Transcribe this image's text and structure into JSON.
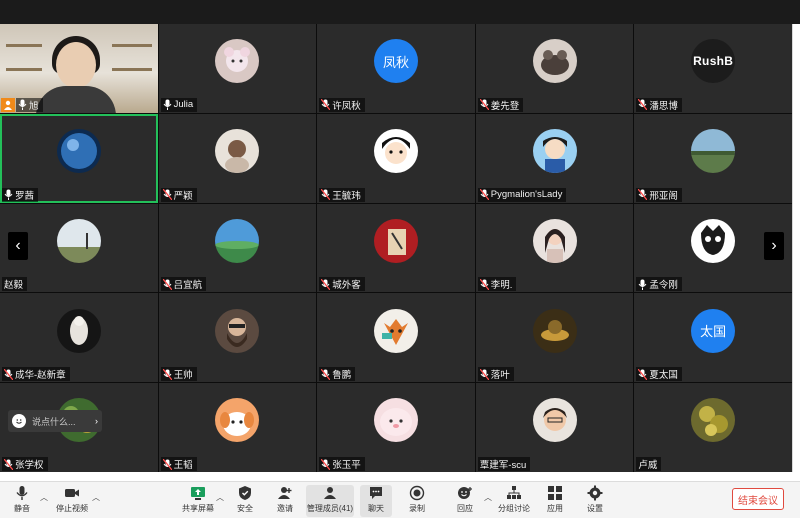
{
  "participants": [
    {
      "name": "旭",
      "kind": "camera"
    },
    {
      "name": "Julia",
      "kind": "photo"
    },
    {
      "name": "许凤秋",
      "kind": "text",
      "avatar_text": "凤秋"
    },
    {
      "name": "姜先登",
      "kind": "photo"
    },
    {
      "name": "潘思博",
      "kind": "dark",
      "avatar_text": "RushB"
    },
    {
      "name": "罗茜",
      "kind": "photo"
    },
    {
      "name": "严颖",
      "kind": "photo"
    },
    {
      "name": "王毓玮",
      "kind": "photo"
    },
    {
      "name": "Pygmalion'sLady",
      "kind": "photo"
    },
    {
      "name": "邢亚阁",
      "kind": "photo"
    },
    {
      "name": "赵毅",
      "kind": "photo"
    },
    {
      "name": "吕宜航",
      "kind": "photo"
    },
    {
      "name": "城外客",
      "kind": "photo"
    },
    {
      "name": "李明.",
      "kind": "photo"
    },
    {
      "name": "孟令刚",
      "kind": "photo"
    },
    {
      "name": "成华-赵新章",
      "kind": "photo"
    },
    {
      "name": "王帅",
      "kind": "photo"
    },
    {
      "name": "鲁鹏",
      "kind": "photo"
    },
    {
      "name": "落叶",
      "kind": "photo"
    },
    {
      "name": "夏太国",
      "kind": "text",
      "avatar_text": "太国"
    },
    {
      "name": "张学权",
      "kind": "photo"
    },
    {
      "name": "王韬",
      "kind": "photo"
    },
    {
      "name": "张玉平",
      "kind": "photo"
    },
    {
      "name": "覃建军-scu",
      "kind": "photo"
    },
    {
      "name": "卢威",
      "kind": "photo"
    }
  ],
  "chat": {
    "placeholder": "说点什么..."
  },
  "toolbar": {
    "mute": "静音",
    "stop_video": "停止视频",
    "share_screen": "共享屏幕",
    "security": "安全",
    "invite": "邀请",
    "manage_members": "管理成员(41)",
    "chat": "聊天",
    "record": "录制",
    "reactions": "回应",
    "breakout": "分组讨论",
    "apps": "应用",
    "settings": "设置",
    "end_meeting": "结束会议"
  },
  "colors": {
    "accent_blue": "#1f80f0",
    "active_border": "#23c05a",
    "end_red": "#e04a3f",
    "host_orange": "#f08a19"
  }
}
